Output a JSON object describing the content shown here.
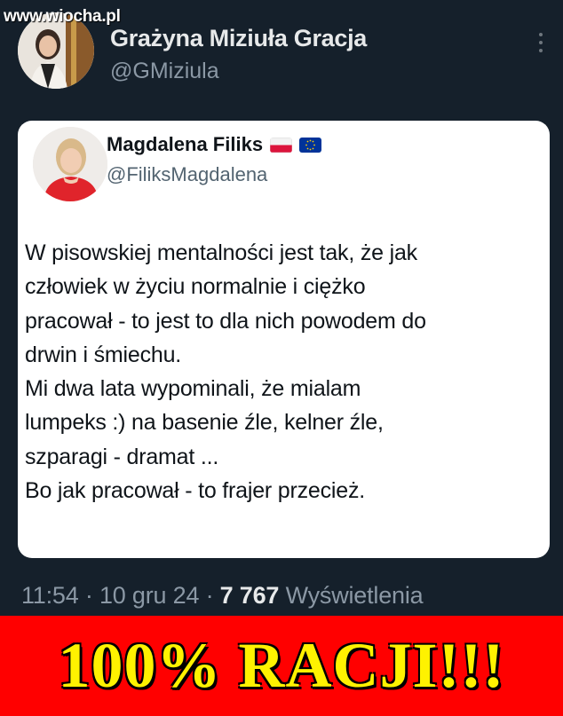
{
  "watermark": "www.wiocha.pl",
  "tweet": {
    "author_name": "Grażyna Miziuła Gracja",
    "author_handle": "@GMiziula",
    "more_icon": "more-vertical-icon"
  },
  "quoted_tweet": {
    "author_name": "Magdalena Filiks",
    "author_handle": "@FiliksMagdalena",
    "flags": [
      "poland-flag-icon",
      "eu-flag-icon"
    ],
    "lines": [
      "W pisowskiej mentalności jest tak, że jak",
      "człowiek w życiu normalnie i ciężko",
      "pracował - to jest to dla nich powodem do",
      "drwin i śmiechu.",
      "Mi dwa lata wypominali, że mialam",
      "lumpeks :) na basenie źle, kelner źle,",
      "szparagi - dramat ...",
      "Bo jak pracował - to frajer przecież."
    ]
  },
  "meta": {
    "time": "11:54",
    "separator": " · ",
    "date": "10 gru 24",
    "views_count": "7 767",
    "views_label": "Wyświetlenia"
  },
  "banner": {
    "text": "100% RACJI!!!"
  },
  "colors": {
    "background": "#15202b",
    "banner_background": "#ff0000",
    "banner_text": "#fff200"
  }
}
